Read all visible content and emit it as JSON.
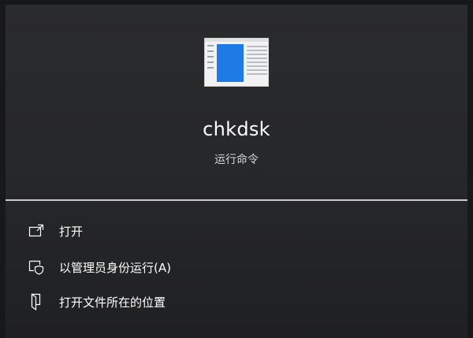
{
  "app": {
    "name": "chkdsk",
    "type": "运行命令"
  },
  "actions": [
    {
      "label": "打开",
      "icon": "open-icon"
    },
    {
      "label": "以管理员身份运行(A)",
      "icon": "shield-icon"
    },
    {
      "label": "打开文件所在的位置",
      "icon": "file-location-icon"
    }
  ],
  "colors": {
    "background": "#262729",
    "text": "#ffffff",
    "subtext": "#d6d6d6",
    "divider": "#c9c9c9",
    "thumbnail_accent": "#1e7be6"
  }
}
